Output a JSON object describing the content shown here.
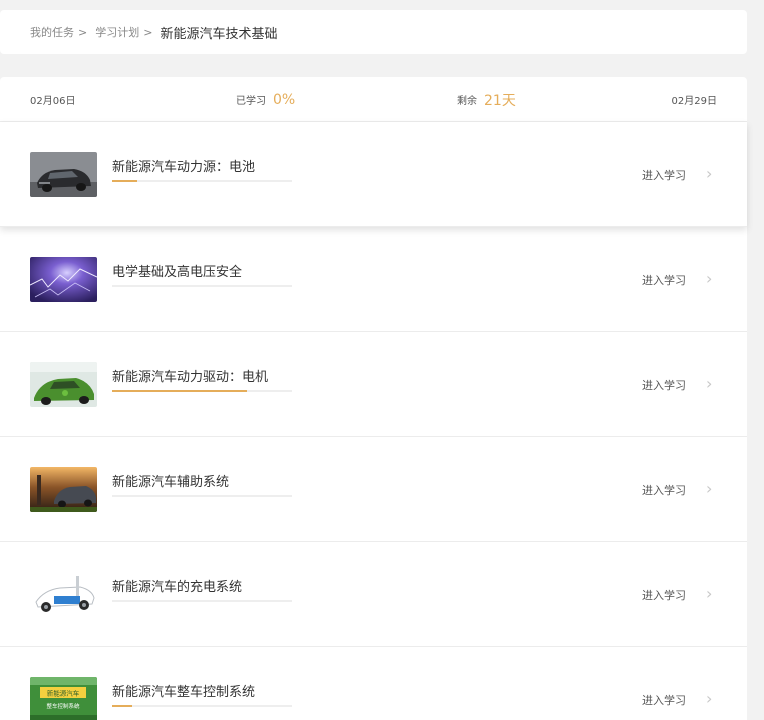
{
  "breadcrumb": {
    "items": [
      "我的任务",
      "学习计划"
    ],
    "separator": ">",
    "current": "新能源汽车技术基础"
  },
  "timeline": {
    "start_date": "02月06日",
    "learned_label": "已学习",
    "learned_value": "0%",
    "remaining_label": "剩余",
    "remaining_value": "21天",
    "end_date": "02月29日"
  },
  "colors": {
    "accent": "#e5ad5a"
  },
  "courses": [
    {
      "title": "新能源汽车动力源：电池",
      "progress": 0.14,
      "action": "进入学习",
      "chevron": "›",
      "icon": "chevron-right-icon"
    },
    {
      "title": "电学基础及高电压安全",
      "progress": 0,
      "action": "进入学习",
      "chevron": "›",
      "icon": "chevron-right-icon"
    },
    {
      "title": "新能源汽车动力驱动：电机",
      "progress": 0.75,
      "action": "进入学习",
      "chevron": "›",
      "icon": "chevron-right-icon"
    },
    {
      "title": "新能源汽车辅助系统",
      "progress": 0,
      "action": "进入学习",
      "chevron": "›",
      "icon": "chevron-right-icon"
    },
    {
      "title": "新能源汽车的充电系统",
      "progress": 0,
      "action": "进入学习",
      "chevron": "›",
      "icon": "chevron-right-icon"
    },
    {
      "title": "新能源汽车整车控制系统",
      "progress": 0.11,
      "action": "进入学习",
      "chevron": "›",
      "icon": "chevron-right-icon",
      "thumb_text": [
        "新能源汽车",
        "整车控制系统"
      ]
    }
  ]
}
